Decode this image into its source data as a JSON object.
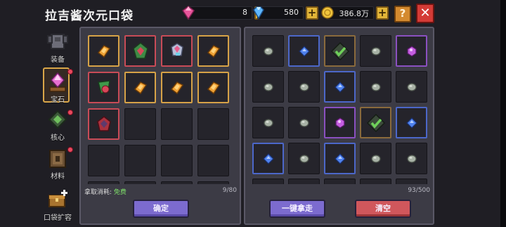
{
  "title": "拉吉酱次元口袋",
  "currencies": [
    {
      "name": "pink-gem",
      "value": "8",
      "color": "#e8559b"
    },
    {
      "name": "blue-diamond",
      "value": "580",
      "color": "#5fb8ff"
    },
    {
      "name": "gold-coin",
      "value": "386.8万",
      "color": "#f0c53c"
    }
  ],
  "plus_label": "+",
  "help_label": "?",
  "close_label": "✕",
  "sidebar": [
    {
      "id": "equip",
      "label": "装备",
      "icon": "armor-icon"
    },
    {
      "id": "gem",
      "label": "宝石",
      "icon": "gem-altar-icon",
      "active": true,
      "badge": true
    },
    {
      "id": "core",
      "label": "核心",
      "icon": "core-chip-icon",
      "badge": true
    },
    {
      "id": "material",
      "label": "材料",
      "icon": "material-book-icon",
      "badge": true
    },
    {
      "id": "expand",
      "label": "口袋扩容",
      "icon": "chest-plus-icon"
    }
  ],
  "left_panel": {
    "cost_label": "拿取消耗:",
    "cost_value": "免费",
    "count": "9/80",
    "confirm_label": "确定",
    "items": [
      {
        "rarity": "gold",
        "icon": "orange-scroll-icon"
      },
      {
        "rarity": "red",
        "icon": "green-red-crystal-icon"
      },
      {
        "rarity": "red",
        "icon": "rainbow-shard-icon"
      },
      {
        "rarity": "gold",
        "icon": "orange-scroll-icon"
      },
      {
        "rarity": "red",
        "icon": "green-leaf-gem-icon"
      },
      {
        "rarity": "gold",
        "icon": "orange-scroll-icon"
      },
      {
        "rarity": "gold",
        "icon": "orange-scroll-icon"
      },
      {
        "rarity": "gold",
        "icon": "orange-scroll-icon"
      },
      {
        "rarity": "red",
        "icon": "red-crystal-icon"
      }
    ]
  },
  "right_panel": {
    "count": "93/500",
    "take_all_label": "一键拿走",
    "clear_label": "清空",
    "items": [
      {
        "rarity": "none",
        "icon": "grey-stone-icon"
      },
      {
        "rarity": "blue",
        "icon": "blue-gem-icon"
      },
      {
        "rarity": "brown",
        "icon": "green-check-core-icon"
      },
      {
        "rarity": "none",
        "icon": "grey-stone-icon"
      },
      {
        "rarity": "purple",
        "icon": "purple-gem-icon"
      },
      {
        "rarity": "none",
        "icon": "grey-stone-icon"
      },
      {
        "rarity": "none",
        "icon": "grey-stone-icon"
      },
      {
        "rarity": "blue",
        "icon": "blue-gem-icon"
      },
      {
        "rarity": "none",
        "icon": "grey-stone-icon"
      },
      {
        "rarity": "none",
        "icon": "grey-stone-icon"
      },
      {
        "rarity": "none",
        "icon": "grey-stone-icon"
      },
      {
        "rarity": "none",
        "icon": "grey-stone-icon"
      },
      {
        "rarity": "purple",
        "icon": "purple-gem-icon"
      },
      {
        "rarity": "brown",
        "icon": "green-check-core-icon"
      },
      {
        "rarity": "blue",
        "icon": "blue-gem-icon"
      },
      {
        "rarity": "blue",
        "icon": "blue-gem-icon"
      },
      {
        "rarity": "none",
        "icon": "grey-stone-icon"
      },
      {
        "rarity": "blue",
        "icon": "blue-gem-icon"
      },
      {
        "rarity": "none",
        "icon": "grey-stone-icon"
      },
      {
        "rarity": "none",
        "icon": "grey-stone-icon"
      }
    ]
  }
}
